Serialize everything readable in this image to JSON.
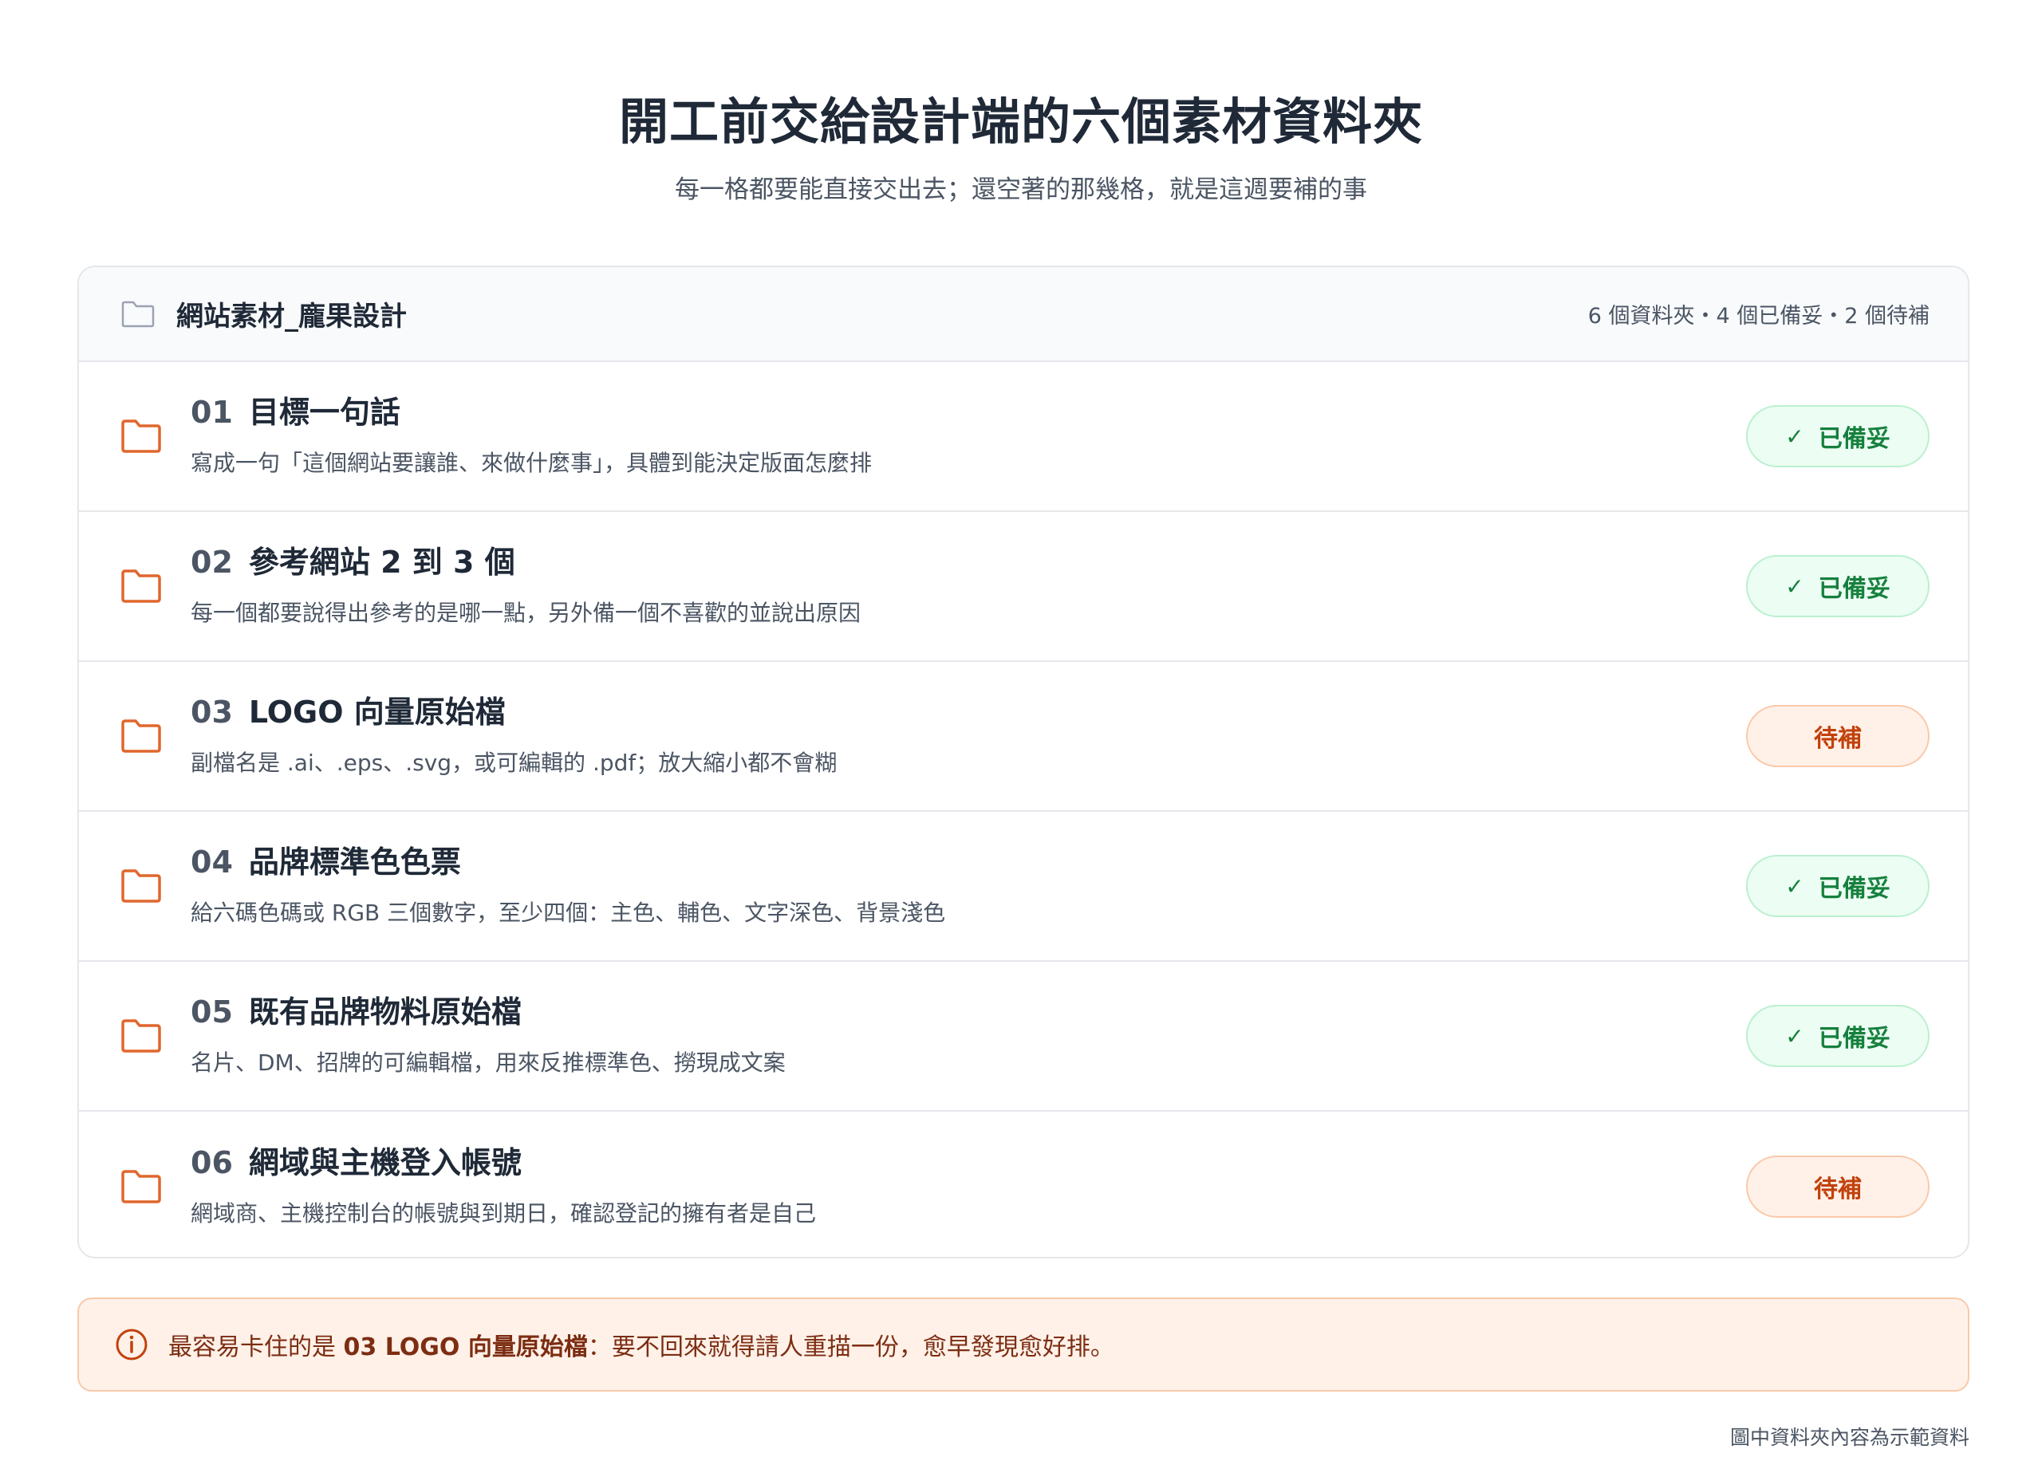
{
  "title": "開工前交給設計端的六個素材資料夾",
  "subtitle": "每一格都要能直接交出去；還空著的那幾格，就是這週要補的事",
  "panel": {
    "name": "網站素材_龐果設計",
    "summary": "6 個資料夾・4 個已備妥・2 個待補"
  },
  "rows": [
    {
      "num": "01",
      "title": "目標一句話",
      "desc": "寫成一句「這個網站要讓誰、來做什麼事」，具體到能決定版面怎麼排",
      "status": "已備妥",
      "check": "✓"
    },
    {
      "num": "02",
      "title": "參考網站 2 到 3 個",
      "desc": "每一個都要說得出參考的是哪一點，另外備一個不喜歡的並說出原因",
      "status": "已備妥",
      "check": "✓"
    },
    {
      "num": "03",
      "title": "LOGO 向量原始檔",
      "desc": "副檔名是 .ai、.eps、.svg，或可編輯的 .pdf；放大縮小都不會糊",
      "status": "待補",
      "check": ""
    },
    {
      "num": "04",
      "title": "品牌標準色色票",
      "desc": "給六碼色碼或 RGB 三個數字，至少四個：主色、輔色、文字深色、背景淺色",
      "status": "已備妥",
      "check": "✓"
    },
    {
      "num": "05",
      "title": "既有品牌物料原始檔",
      "desc": "名片、DM、招牌的可編輯檔，用來反推標準色、撈現成文案",
      "status": "已備妥",
      "check": "✓"
    },
    {
      "num": "06",
      "title": "網域與主機登入帳號",
      "desc": "網域商、主機控制台的帳號與到期日，確認登記的擁有者是自己",
      "status": "待補",
      "check": ""
    }
  ],
  "note": {
    "prefix": "最容易卡住的是 ",
    "strong": "03 LOGO 向量原始檔",
    "suffix": "：要不回來就得請人重描一份，愈早發現愈好排。"
  },
  "footnote": "圖中資料夾內容為示範資料",
  "colors": {
    "folder_accent": "#e0672d",
    "ready_text": "#15803d",
    "ready_bg": "#ecfdf3",
    "pending_text": "#c2410c",
    "pending_bg": "#fff1e8"
  },
  "icons": {
    "header": "folder-outline-icon",
    "row": "folder-icon",
    "ready": "check-icon",
    "note": "info-icon"
  }
}
